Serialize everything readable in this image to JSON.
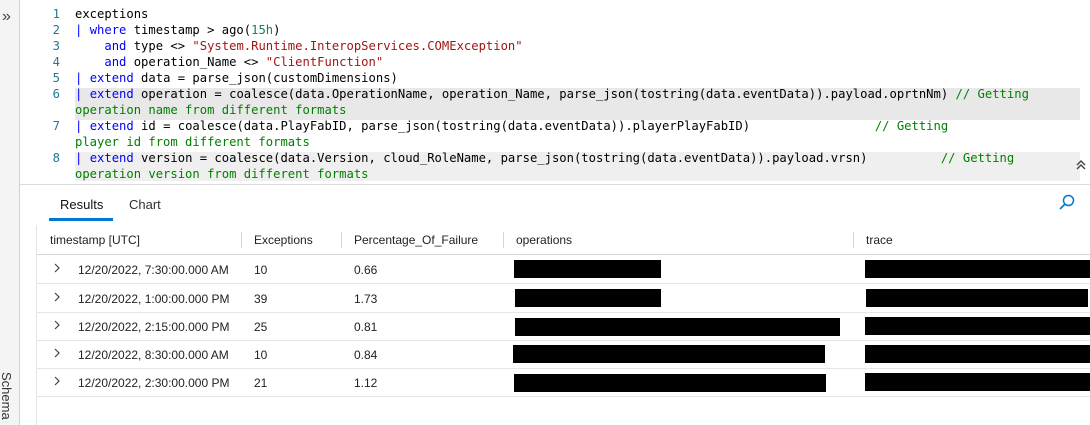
{
  "rail": {
    "expand_icon": "»",
    "schema_label": "Schema"
  },
  "editor": {
    "lines": [
      {
        "n": "1",
        "segs": [
          [
            "exceptions",
            ""
          ]
        ]
      },
      {
        "n": "2",
        "segs": [
          [
            "| ",
            "kw"
          ],
          [
            "where",
            "kw"
          ],
          [
            " timestamp > ago(",
            ""
          ],
          [
            "15h",
            "num"
          ],
          [
            ")",
            ""
          ]
        ]
      },
      {
        "n": "3",
        "segs": [
          [
            "    ",
            ""
          ],
          [
            "and",
            "kw"
          ],
          [
            " type <> ",
            ""
          ],
          [
            "\"System.Runtime.InteropServices.COMException\"",
            "str"
          ]
        ]
      },
      {
        "n": "4",
        "segs": [
          [
            "    ",
            ""
          ],
          [
            "and",
            "kw"
          ],
          [
            " operation_Name <> ",
            ""
          ],
          [
            "\"ClientFunction\"",
            "str"
          ]
        ]
      },
      {
        "n": "5",
        "segs": [
          [
            "| ",
            "kw"
          ],
          [
            "extend",
            "kw"
          ],
          [
            " data = parse_json(customDimensions)",
            ""
          ]
        ]
      },
      {
        "n": "6",
        "segs": [
          [
            "| ",
            "kw"
          ],
          [
            "extend",
            "kw"
          ],
          [
            " operation = coalesce(data.OperationName, operation_Name, parse_json(tostring(data.eventData)).payload.oprtnNm) ",
            ""
          ],
          [
            "// Getting",
            "cmt"
          ]
        ]
      },
      {
        "n": "",
        "segs": [
          [
            "operation name from different formats",
            "cmt"
          ]
        ]
      },
      {
        "n": "7",
        "segs": [
          [
            "| ",
            "kw"
          ],
          [
            "extend",
            "kw"
          ],
          [
            " id = coalesce(data.PlayFabID, parse_json(tostring(data.eventData)).playerPlayFabID)                 ",
            ""
          ],
          [
            "// Getting",
            "cmt"
          ]
        ]
      },
      {
        "n": "",
        "segs": [
          [
            "player id from different formats",
            "cmt"
          ]
        ]
      },
      {
        "n": "8",
        "segs": [
          [
            "| ",
            "kw"
          ],
          [
            "extend",
            "kw"
          ],
          [
            " version = coalesce(data.Version, cloud_RoleName, parse_json(tostring(data.eventData)).payload.vrsn)          ",
            ""
          ],
          [
            "// Getting",
            "cmt"
          ]
        ]
      },
      {
        "n": "",
        "segs": [
          [
            "operation version from different formats",
            "cmt"
          ]
        ]
      }
    ],
    "splitter": "...",
    "collapse_icon": "chevron-up-double-icon"
  },
  "tabs": [
    {
      "label": "Results",
      "active": true
    },
    {
      "label": "Chart",
      "active": false
    }
  ],
  "table": {
    "columns": [
      "timestamp [UTC]",
      "Exceptions",
      "Percentage_Of_Failure",
      "operations",
      "trace"
    ],
    "rows": [
      {
        "timestamp": "12/20/2022, 7:30:00.000 AM",
        "exceptions": "10",
        "failure": "0.66"
      },
      {
        "timestamp": "12/20/2022, 1:00:00.000 PM",
        "exceptions": "39",
        "failure": "1.73"
      },
      {
        "timestamp": "12/20/2022, 2:15:00.000 PM",
        "exceptions": "25",
        "failure": "0.81"
      },
      {
        "timestamp": "12/20/2022, 8:30:00.000 AM",
        "exceptions": "10",
        "failure": "0.84"
      },
      {
        "timestamp": "12/20/2022, 2:30:00.000 PM",
        "exceptions": "21",
        "failure": "1.12"
      }
    ]
  },
  "colors": {
    "accent": "#0078d4",
    "keyword": "#0000ff",
    "string": "#a31515",
    "comment": "#008000",
    "line_number": "#237893"
  }
}
